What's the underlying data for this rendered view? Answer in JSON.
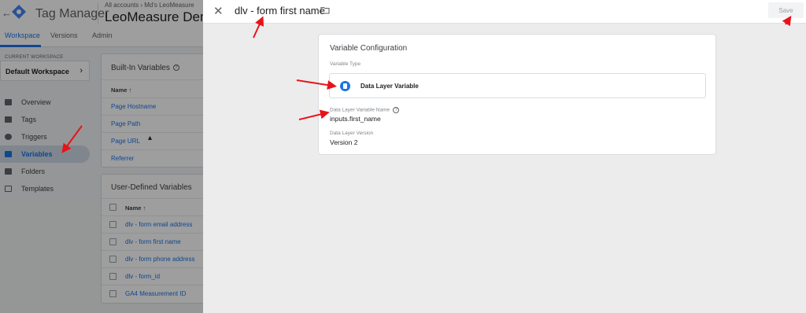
{
  "background": {
    "app_title": "Tag Manager",
    "breadcrumb": "All accounts › Md's LeoMeasure",
    "container_name": "LeoMeasure Demo Site",
    "tabs": [
      {
        "label": "Workspace"
      },
      {
        "label": "Versions"
      },
      {
        "label": "Admin"
      }
    ],
    "current_workspace_label": "CURRENT WORKSPACE",
    "workspace_name": "Default Workspace",
    "nav": [
      {
        "label": "Overview"
      },
      {
        "label": "Tags"
      },
      {
        "label": "Triggers"
      },
      {
        "label": "Variables"
      },
      {
        "label": "Folders"
      },
      {
        "label": "Templates"
      }
    ],
    "builtin": {
      "title": "Built-In Variables",
      "col_name": "Name ↑",
      "rows": [
        "Page Hostname",
        "Page Path",
        "Page URL",
        "Referrer"
      ]
    },
    "user_defined": {
      "title": "User-Defined Variables",
      "col_name": "Name ↑",
      "rows": [
        "dlv - form email address",
        "dlv - form first name",
        "dlv - form phone address",
        "dlv - form_id",
        "GA4 Measurement ID"
      ]
    }
  },
  "panel": {
    "variable_name": "dlv - form first name",
    "save_label": "Save",
    "config": {
      "title": "Variable Configuration",
      "type_label": "Variable Type",
      "type_name": "Data Layer Variable",
      "dlv_name_label": "Data Layer Variable Name",
      "dlv_name_value": "inputs.first_name",
      "version_label": "Data Layer Version",
      "version_value": "Version 2"
    }
  },
  "colors": {
    "accent": "#1a73e8",
    "annotation_arrow": "#e8131a"
  }
}
